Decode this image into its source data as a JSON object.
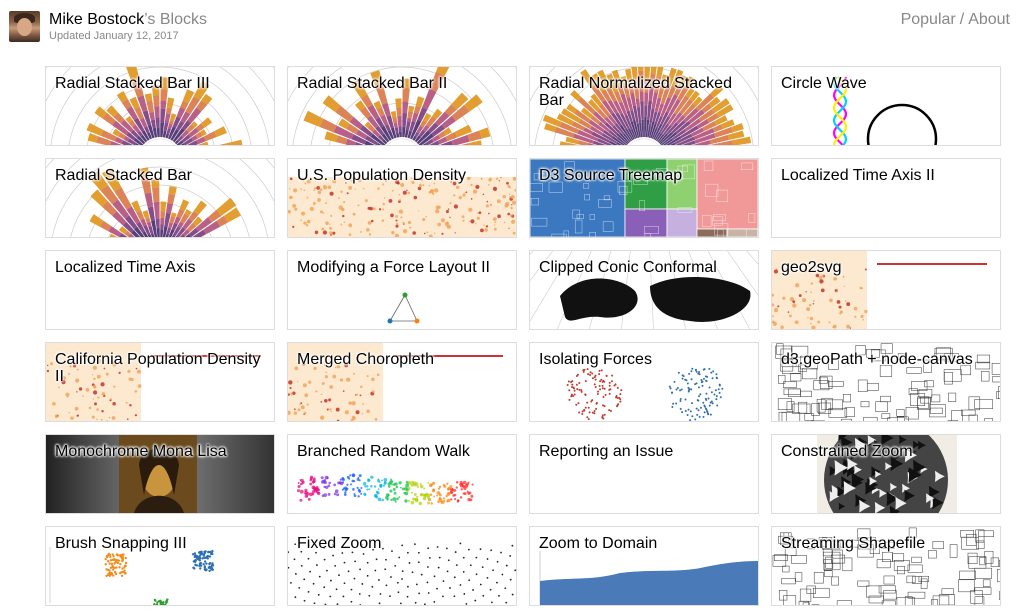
{
  "header": {
    "owner": "Mike Bostock",
    "suffix": "’s Blocks",
    "updated": "Updated January 12, 2017",
    "nav": {
      "popular": "Popular",
      "separator": "/",
      "about": "About"
    }
  },
  "blocks": [
    {
      "title": "Radial Stacked Bar III",
      "thumb": "radial-bar"
    },
    {
      "title": "Radial Stacked Bar II",
      "thumb": "radial-bar-2"
    },
    {
      "title": "Radial Normalized Stacked Bar",
      "thumb": "radial-normalized"
    },
    {
      "title": "Circle Wave",
      "thumb": "circle-wave"
    },
    {
      "title": "Radial Stacked Bar",
      "thumb": "radial-bar-3"
    },
    {
      "title": "U.S. Population Density",
      "thumb": "us-density"
    },
    {
      "title": "D3 Source Treemap",
      "thumb": "treemap"
    },
    {
      "title": "Localized Time Axis II",
      "thumb": "blank"
    },
    {
      "title": "Localized Time Axis",
      "thumb": "blank"
    },
    {
      "title": "Modifying a Force Layout II",
      "thumb": "force"
    },
    {
      "title": "Clipped Conic Conformal",
      "thumb": "conic"
    },
    {
      "title": "geo2svg",
      "thumb": "california"
    },
    {
      "title": "California Population Density II",
      "thumb": "california"
    },
    {
      "title": "Merged Choropleth",
      "thumb": "california"
    },
    {
      "title": "Isolating Forces",
      "thumb": "forces"
    },
    {
      "title": "d3.geoPath + node-canvas",
      "thumb": "counties"
    },
    {
      "title": "Monochrome Mona Lisa",
      "thumb": "mona"
    },
    {
      "title": "Branched Random Walk",
      "thumb": "walk"
    },
    {
      "title": "Reporting an Issue",
      "thumb": "blank"
    },
    {
      "title": "Constrained Zoom",
      "thumb": "escher"
    },
    {
      "title": "Brush Snapping III",
      "thumb": "brush"
    },
    {
      "title": "Fixed Zoom",
      "thumb": "dots"
    },
    {
      "title": "Zoom to Domain",
      "thumb": "area"
    },
    {
      "title": "Streaming Shapefile",
      "thumb": "counties"
    }
  ]
}
